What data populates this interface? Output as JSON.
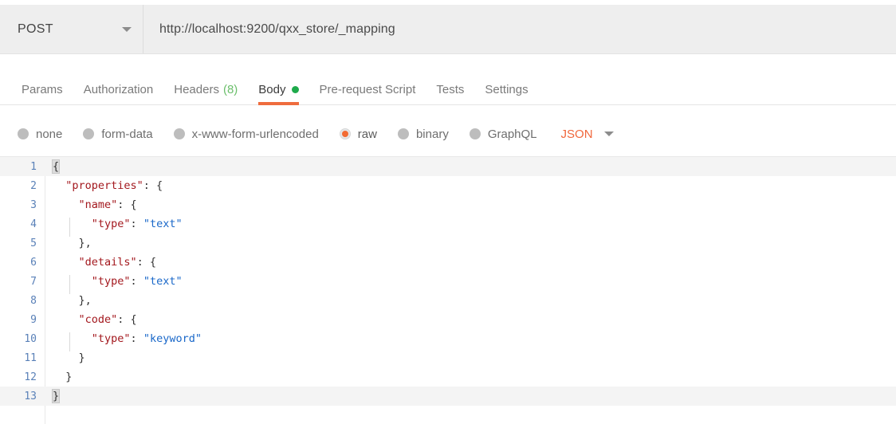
{
  "request": {
    "method": "POST",
    "method_caret_icon": "chevron-down-icon",
    "url": "http://localhost:9200/qxx_store/_mapping"
  },
  "tabs": [
    {
      "label": "Params",
      "active": false
    },
    {
      "label": "Authorization",
      "active": false
    },
    {
      "label": "Headers",
      "count": "(8)",
      "active": false
    },
    {
      "label": "Body",
      "dot": true,
      "active": true
    },
    {
      "label": "Pre-request Script",
      "active": false
    },
    {
      "label": "Tests",
      "active": false
    },
    {
      "label": "Settings",
      "active": false
    }
  ],
  "body_types": [
    {
      "label": "none",
      "selected": false
    },
    {
      "label": "form-data",
      "selected": false
    },
    {
      "label": "x-www-form-urlencoded",
      "selected": false
    },
    {
      "label": "raw",
      "selected": true
    },
    {
      "label": "binary",
      "selected": false
    },
    {
      "label": "GraphQL",
      "selected": false
    }
  ],
  "format": {
    "label": "JSON",
    "caret_icon": "chevron-down-icon"
  },
  "editor": {
    "lines": [
      {
        "num": "1",
        "indent": 0,
        "cursor": true,
        "tokens": [
          {
            "t": "{",
            "c": "punct",
            "hl": true
          }
        ]
      },
      {
        "num": "2",
        "indent": 0,
        "cursor": false,
        "tokens": [
          {
            "t": "  \"properties\"",
            "c": "key"
          },
          {
            "t": ": {",
            "c": "punct"
          }
        ]
      },
      {
        "num": "3",
        "indent": 0,
        "cursor": false,
        "tokens": [
          {
            "t": "    \"name\"",
            "c": "key"
          },
          {
            "t": ": {",
            "c": "punct"
          }
        ]
      },
      {
        "num": "4",
        "indent": 1,
        "cursor": false,
        "tokens": [
          {
            "t": "      \"type\"",
            "c": "key"
          },
          {
            "t": ": ",
            "c": "punct"
          },
          {
            "t": "\"text\"",
            "c": "str"
          }
        ]
      },
      {
        "num": "5",
        "indent": 0,
        "cursor": false,
        "tokens": [
          {
            "t": "    },",
            "c": "punct"
          }
        ]
      },
      {
        "num": "6",
        "indent": 0,
        "cursor": false,
        "tokens": [
          {
            "t": "    \"details\"",
            "c": "key"
          },
          {
            "t": ": {",
            "c": "punct"
          }
        ]
      },
      {
        "num": "7",
        "indent": 1,
        "cursor": false,
        "tokens": [
          {
            "t": "      \"type\"",
            "c": "key"
          },
          {
            "t": ": ",
            "c": "punct"
          },
          {
            "t": "\"text\"",
            "c": "str"
          }
        ]
      },
      {
        "num": "8",
        "indent": 0,
        "cursor": false,
        "tokens": [
          {
            "t": "    },",
            "c": "punct"
          }
        ]
      },
      {
        "num": "9",
        "indent": 0,
        "cursor": false,
        "tokens": [
          {
            "t": "    \"code\"",
            "c": "key"
          },
          {
            "t": ": {",
            "c": "punct"
          }
        ]
      },
      {
        "num": "10",
        "indent": 1,
        "cursor": false,
        "tokens": [
          {
            "t": "      \"type\"",
            "c": "key"
          },
          {
            "t": ": ",
            "c": "punct"
          },
          {
            "t": "\"keyword\"",
            "c": "str"
          }
        ]
      },
      {
        "num": "11",
        "indent": 0,
        "cursor": false,
        "tokens": [
          {
            "t": "    }",
            "c": "punct"
          }
        ]
      },
      {
        "num": "12",
        "indent": 0,
        "cursor": false,
        "tokens": [
          {
            "t": "  }",
            "c": "punct"
          }
        ]
      },
      {
        "num": "13",
        "indent": 0,
        "cursor": true,
        "tokens": [
          {
            "t": "}",
            "c": "punct",
            "hl": true
          }
        ]
      }
    ]
  },
  "colors": {
    "accent_orange": "#ef6c3e",
    "green": "#1eaa4b",
    "count_green": "#6cbf6c",
    "json_key": "#a3181e",
    "json_string": "#1a68c9",
    "line_number": "#5a81b8",
    "field_bg": "#eeeeee"
  }
}
